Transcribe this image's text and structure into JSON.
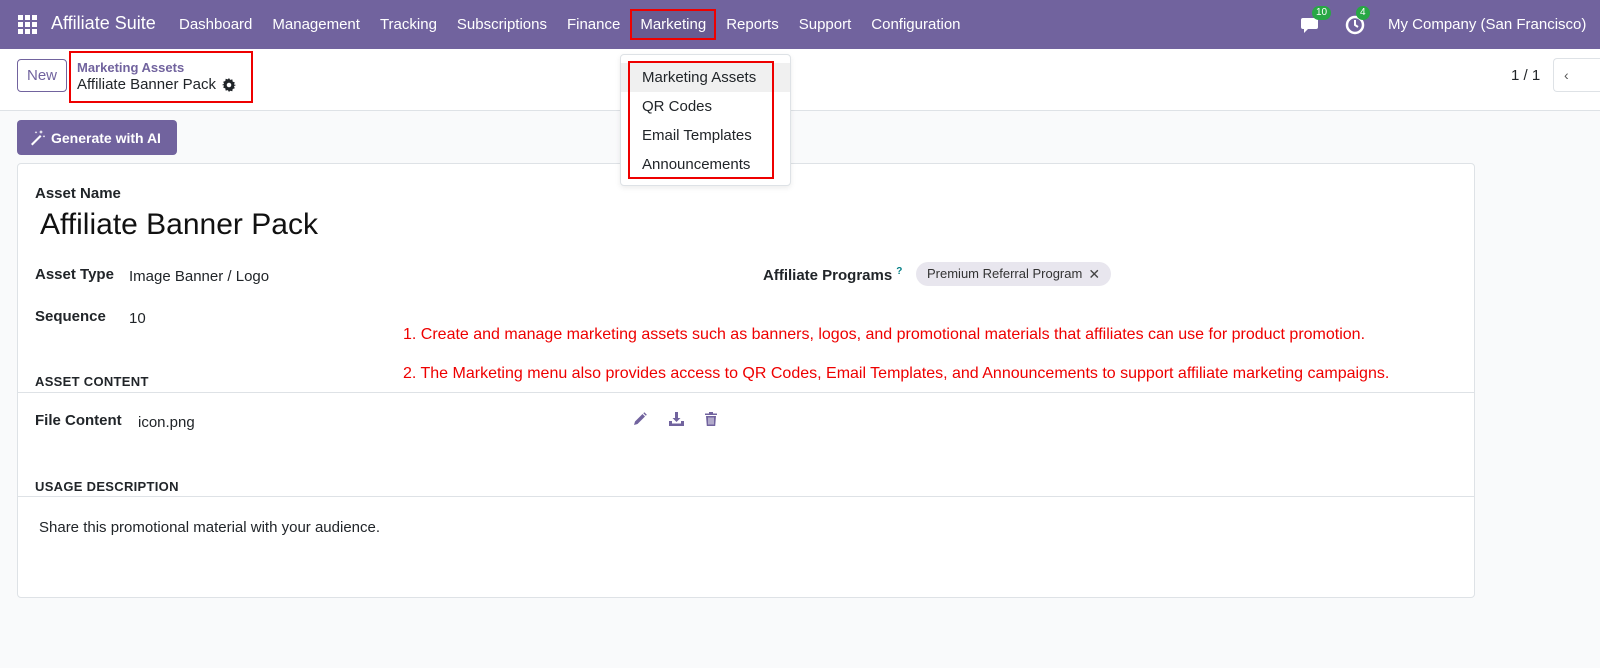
{
  "topbar": {
    "brand": "Affiliate Suite",
    "menu": [
      "Dashboard",
      "Management",
      "Tracking",
      "Subscriptions",
      "Finance",
      "Marketing",
      "Reports",
      "Support",
      "Configuration"
    ],
    "messages_badge": "10",
    "activities_badge": "4",
    "company": "My Company (San Francisco)",
    "color": "#71639e"
  },
  "control": {
    "new_label": "New",
    "breadcrumb_parent": "Marketing Assets",
    "breadcrumb_current": "Affiliate Banner Pack",
    "pager": "1 / 1",
    "pager_prev": "‹"
  },
  "ai_button": {
    "label": "Generate with AI"
  },
  "form": {
    "asset_name_label": "Asset Name",
    "asset_name": "Affiliate Banner Pack",
    "asset_type_label": "Asset Type",
    "asset_type": "Image Banner / Logo",
    "sequence_label": "Sequence",
    "sequence": "10",
    "programs_label": "Affiliate Programs",
    "programs_help": "?",
    "program_tag": "Premium Referral Program",
    "asset_content_title": "ASSET CONTENT",
    "file_content_label": "File Content",
    "file_name": "icon.png",
    "usage_title": "USAGE DESCRIPTION",
    "usage_text": "Share this promotional material with your audience."
  },
  "annotations": [
    "1. Create and manage marketing assets such as banners, logos, and promotional materials that affiliates can use for product promotion.",
    "2. The Marketing menu also provides access to QR Codes, Email Templates, and Announcements to support affiliate marketing campaigns."
  ],
  "dropdown": {
    "items": [
      "Marketing Assets",
      "QR Codes",
      "Email Templates",
      "Announcements"
    ]
  },
  "colors": {
    "highlight": "#ee0000",
    "primary": "#71639e",
    "badge": "#28a745"
  }
}
